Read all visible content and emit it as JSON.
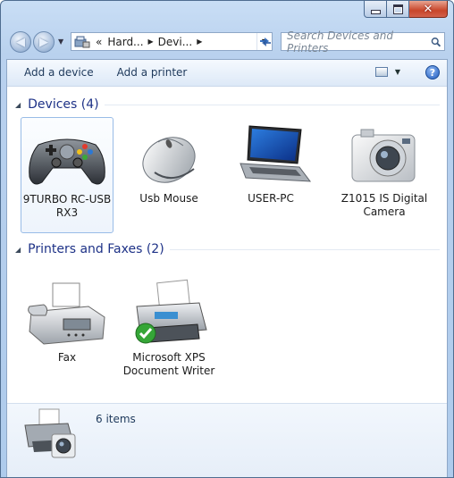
{
  "window": {
    "caption": {
      "min_icon": "minimize-icon",
      "max_icon": "maximize-icon",
      "close_icon": "close-icon"
    }
  },
  "nav": {
    "back_icon": "back-arrow-icon",
    "forward_icon": "forward-arrow-icon",
    "history_icon": "history-dropdown-icon",
    "breadcrumb_chevrons": "«",
    "breadcrumb": [
      "Hard...",
      "Devi..."
    ],
    "refresh_icon": "refresh-icon",
    "search_placeholder": "Search Devices and Printers"
  },
  "commands": {
    "add_device": "Add a device",
    "add_printer": "Add a printer",
    "views_icon": "views-icon",
    "help_icon": "help-icon"
  },
  "groups": [
    {
      "title": "Devices (4)",
      "items": [
        {
          "label": "9TURBO RC-USB RX3",
          "icon": "gamepad-icon",
          "selected": true
        },
        {
          "label": "Usb Mouse",
          "icon": "mouse-icon"
        },
        {
          "label": "USER-PC",
          "icon": "laptop-icon"
        },
        {
          "label": "Z1015 IS Digital Camera",
          "icon": "camera-icon"
        }
      ]
    },
    {
      "title": "Printers and Faxes (2)",
      "items": [
        {
          "label": "Fax",
          "icon": "fax-icon"
        },
        {
          "label": "Microsoft XPS Document Writer",
          "icon": "printer-icon",
          "default": true
        }
      ]
    }
  ],
  "details": {
    "count_text": "6 items",
    "icon": "devices-and-printers-icon"
  },
  "colors": {
    "group_title": "#1e3287",
    "window_frame": "#b9d1ee",
    "close_button": "#c8452a"
  }
}
